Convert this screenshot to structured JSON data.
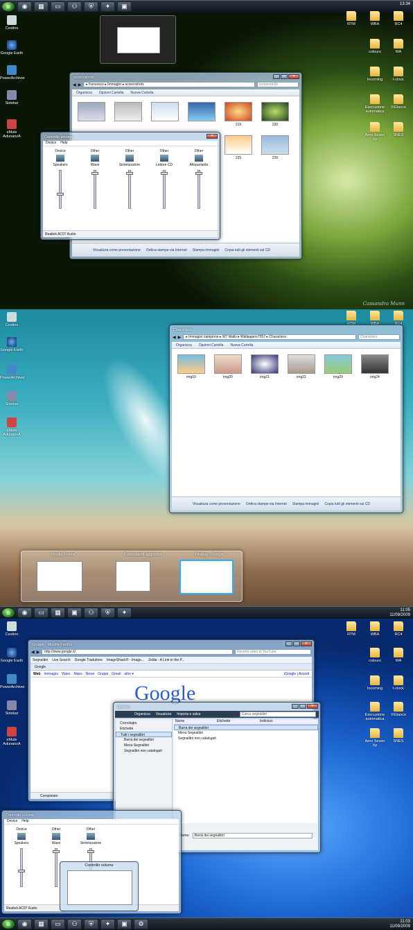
{
  "panel1": {
    "clock": "13:34",
    "taskbar_icons": [
      "start-icon",
      "firefox-icon",
      "app-icon",
      "window-icon",
      "gamepad-icon",
      "shield-icon",
      "joystick-icon",
      "monitor-icon"
    ],
    "desktop_left": [
      "Cestino",
      "Google Earth",
      "PowerArchiver",
      "Sidebar",
      "eMule AdunanzA"
    ],
    "desktop_right": [
      [
        "RTM",
        "WBA",
        "RC4"
      ],
      [
        "colours",
        "WA"
      ],
      [
        "Incoming",
        "t-clock"
      ],
      [
        "Esecuzione automatica",
        "ViGlance"
      ],
      [
        "Aero Seven Xp",
        "SNES"
      ]
    ],
    "explorer": {
      "title": "screenshots",
      "path": [
        "francesco",
        "Immagini",
        "screenshots"
      ],
      "search": "screenshots",
      "toolbar": [
        "Organizza",
        "Opzioni Cartella",
        "Nuova Cartella"
      ],
      "thumbs": [
        "",
        "",
        "",
        "",
        "219",
        "220",
        "",
        "",
        "",
        "",
        "225",
        "226"
      ],
      "details": [
        "Visualizza come presentazione",
        "Ordina stampe via Internet",
        "Stampa immagini",
        "Copia tutti gli elementi sul CD"
      ]
    },
    "volume": {
      "title": "Controllo volume",
      "menu": [
        "Device",
        "Help"
      ],
      "channels": [
        {
          "type": "Device",
          "name": "Speakers"
        },
        {
          "type": "Other",
          "name": "Wave"
        },
        {
          "type": "Other",
          "name": "Sintetizzatore"
        },
        {
          "type": "Other",
          "name": "Lettore CD"
        },
        {
          "type": "Other",
          "name": "Altoparlante"
        }
      ],
      "footer": "Realtek AC97 Audio"
    },
    "watermark": "Cassandra Munn"
  },
  "panel2": {
    "clock": "11:05",
    "date": "11/09/2009",
    "desktop_left": [
      "Cestino",
      "Google Earth",
      "PowerArchiver",
      "Sidebar",
      "eMule AdunanzA"
    ],
    "desktop_right": [
      [
        "RTM",
        "WBA",
        "RC4"
      ]
    ],
    "explorer": {
      "title": "Characters",
      "path": [
        "Immagini campione",
        "W7 Walls",
        "Wallpapers7057",
        "Characters"
      ],
      "search": "Characters",
      "toolbar": [
        "Organizza",
        "Opzioni Cartella",
        "Nuova Cartella"
      ],
      "thumbs": [
        "img19",
        "img20",
        "img21",
        "img22",
        "img23",
        "img24"
      ],
      "details": [
        "Visualizza come presentazione",
        "Ordina stampe via Internet",
        "Stampa immagini",
        "Copia tutti gli elementi sul CD"
      ]
    },
    "flip": [
      "Mozilla Firefox",
      "Componenti aggiuntivi",
      "Firebug - Google"
    ]
  },
  "panel3": {
    "clock": "11:03",
    "date": "11/09/2009",
    "desktop_left": [
      "Cestino",
      "Google Earth",
      "PowerArchiver",
      "Sidebar",
      "eMule AdunanzA"
    ],
    "desktop_right": [
      [
        "RTM",
        "WBA",
        "RC4"
      ],
      [
        "colours",
        "WA"
      ],
      [
        "Incoming",
        "t-clock"
      ],
      [
        "Esecuzione automatica",
        "ViGlance"
      ],
      [
        "Aero Seven Xp",
        "SNES"
      ]
    ],
    "firefox": {
      "title": "Google - Mozilla Firefox",
      "url": "http://www.google.it/",
      "search": "Recenti video di YouTube",
      "bookmarks": [
        "Segnalibri",
        "Live Search",
        "Google Traduttore",
        "ImageShack® - Image...",
        "Zelda - A Link to the P..."
      ],
      "tab": "Google",
      "nav": [
        "Web",
        "Immagini",
        "Video",
        "Maps",
        "News",
        "Gruppi",
        "Gmail",
        "altro ▾"
      ],
      "nav_right": "iGoogle | Accedi",
      "logo": "Google",
      "status": "Completato"
    },
    "library": {
      "title": "Libreria",
      "toolbar": [
        "Organizza",
        "Visualizza",
        "Importa e salva"
      ],
      "search": "Cerca segnalibri",
      "tree": [
        "Cronologia",
        "Etichette",
        "Tutti i segnalibri",
        "Barra dei segnalibri",
        "Menu Segnalibri",
        "Segnalibri non catalogati"
      ],
      "columns": [
        "Nome",
        "Etichette",
        "Indirizzo"
      ],
      "rows": [
        "Barra dei segnalibri",
        "Menu Segnalibri",
        "Segnalibri non catalogati"
      ],
      "name_label": "Nome:",
      "name_value": "Barra dei segnalibri"
    },
    "volume": {
      "title": "Controllo volume",
      "menu": [
        "Device",
        "Help"
      ],
      "channels": [
        {
          "type": "Device",
          "name": "Speakers"
        },
        {
          "type": "Other",
          "name": "Wave"
        },
        {
          "type": "Other",
          "name": "Sintetizzatore"
        }
      ],
      "footer": "Realtek AC97 Audio",
      "peek_title": "Controllo volume"
    }
  }
}
